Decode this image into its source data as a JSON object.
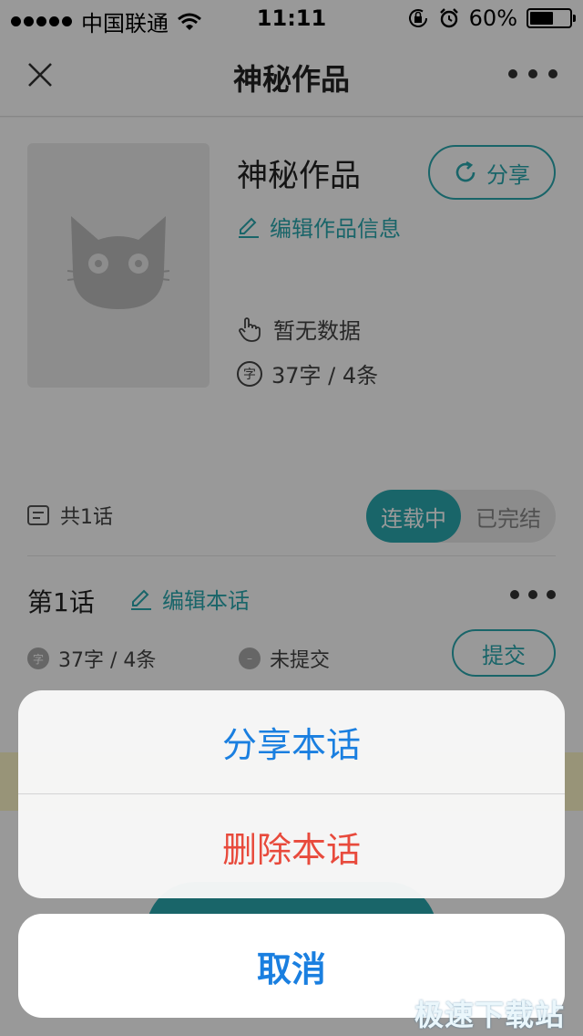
{
  "status_bar": {
    "carrier": "中国联通",
    "time": "11:11",
    "battery": "60%",
    "battery_level": 0.6
  },
  "nav": {
    "title": "神秘作品",
    "close_icon": "close-icon",
    "more_icon": "more-icon"
  },
  "work": {
    "title": "神秘作品",
    "share_label": "分享",
    "edit_label": "编辑作品信息",
    "likes_text": "暂无数据",
    "words_text": "37字 / 4条",
    "word_badge": "字"
  },
  "episodes": {
    "count_label": "共1话",
    "status_toggle": {
      "serializing": "连载中",
      "completed": "已完结",
      "selected": "连载中"
    },
    "items": [
      {
        "title": "第1话",
        "edit_label": "编辑本话",
        "words_text": "37字 / 4条",
        "submit_status": "未提交",
        "submit_label": "提交"
      }
    ]
  },
  "action_sheet": {
    "share_label": "分享本话",
    "delete_label": "删除本话",
    "cancel_label": "取消"
  },
  "colors": {
    "accent": "#2aa8b0",
    "ios_blue": "#1a7fe0",
    "destructive": "#e84a3c"
  },
  "watermark": "极速下载站"
}
